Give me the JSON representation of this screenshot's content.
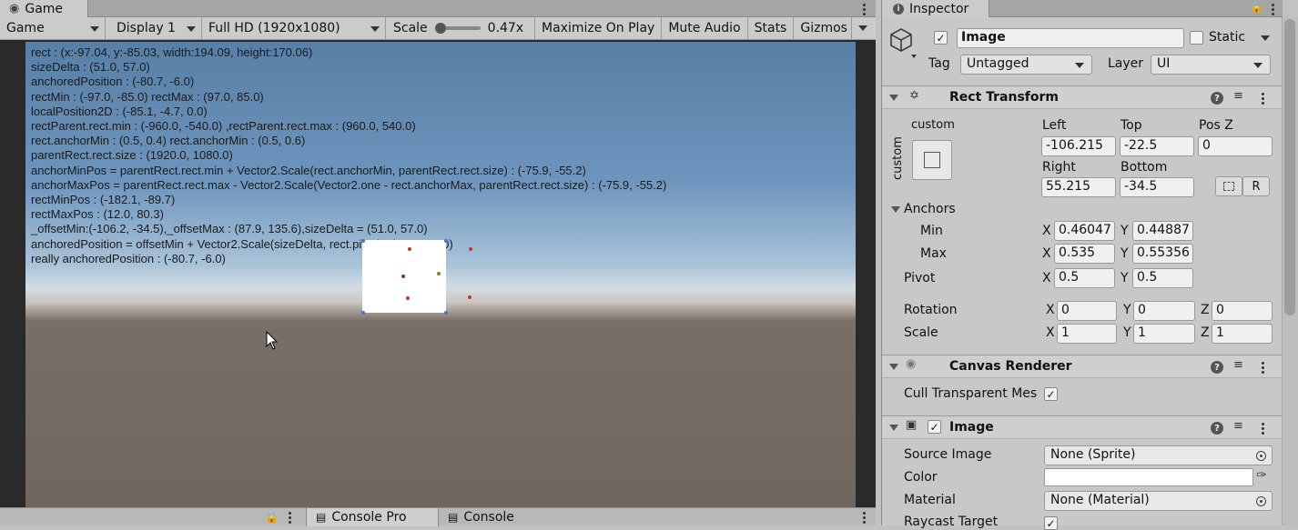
{
  "game": {
    "tab_label": "Game",
    "toolbar": {
      "view_mode": "Game",
      "display": "Display 1",
      "resolution": "Full HD (1920x1080)",
      "scale_label": "Scale",
      "scale_value": "0.47x",
      "scale_level": 0.0,
      "maximize_on_play": "Maximize On Play",
      "mute_audio": "Mute Audio",
      "stats": "Stats",
      "gizmos": "Gizmos"
    },
    "debug_lines": [
      "rect : (x:-97.04, y:-85.03, width:194.09, height:170.06)",
      "sizeDelta : (51.0, 57.0)",
      " anchoredPosition : (-80.7, -6.0)",
      " rectMin : (-97.0, -85.0)  rectMax : (97.0, 85.0)",
      " localPosition2D  : (-85.1, -4.7, 0.0)",
      " rectParent.rect.min   : (-960.0, -540.0) ,rectParent.rect.max   : (960.0, 540.0)",
      " rect.anchorMin   : (0.5, 0.4)   rect.anchorMin   : (0.5, 0.6)",
      " parentRect.rect.size   : (1920.0, 1080.0)",
      " anchorMinPos = parentRect.rect.min + Vector2.Scale(rect.anchorMin, parentRect.rect.size) : (-75.9, -55.2)",
      " anchorMaxPos = parentRect.rect.max - Vector2.Scale(Vector2.one - rect.anchorMax, parentRect.rect.size)  : (-75.9, -55.2)",
      " rectMinPos    : (-182.1, -89.7)",
      " rectMaxPos     : (12.0, 80.3)",
      " _offsetMin:(-106.2, -34.5),_offsetMax : (87.9, 135.6),sizeDelta = (51.0, 57.0)",
      " anchoredPosition = offsetMin + Vector2.Scale(sizeDelta, rect.pivot)      : (-80.7, -6.0)",
      " really anchoredPosition : (-80.7, -6.0)"
    ],
    "bottom_tabs": [
      "Console Pro",
      "Console"
    ]
  },
  "inspector": {
    "tab_label": "Inspector",
    "object": {
      "active": true,
      "name": "Image",
      "static_label": "Static",
      "static": false,
      "tag_label": "Tag",
      "tag": "Untagged",
      "layer_label": "Layer",
      "layer": "UI"
    },
    "rect_transform": {
      "title": "Rect Transform",
      "preset_label": "custom",
      "preset_side": "custom",
      "left_label": "Left",
      "left": "-106.215",
      "top_label": "Top",
      "top": "-22.5",
      "posz_label": "Pos Z",
      "posz": "0",
      "right_label": "Right",
      "right": "55.215",
      "bottom_label": "Bottom",
      "bottom": "-34.5",
      "r_button": "R",
      "anchors_label": "Anchors",
      "min_label": "Min",
      "min_x": "0.46047",
      "min_y": "0.44887",
      "max_label": "Max",
      "max_x": "0.535",
      "max_y": "0.55356",
      "pivot_label": "Pivot",
      "pivot_x": "0.5",
      "pivot_y": "0.5",
      "rotation_label": "Rotation",
      "rot_x": "0",
      "rot_y": "0",
      "rot_z": "0",
      "scale_label": "Scale",
      "scale_x": "1",
      "scale_y": "1",
      "scale_z": "1",
      "x": "X",
      "y": "Y",
      "z": "Z"
    },
    "canvas_renderer": {
      "title": "Canvas Renderer",
      "cull_label": "Cull Transparent Mes",
      "cull": true
    },
    "image": {
      "title": "Image",
      "enabled": true,
      "source_label": "Source Image",
      "source": "None (Sprite)",
      "color_label": "Color",
      "color": "#ffffff",
      "material_label": "Material",
      "material": "None (Material)",
      "raycast_label": "Raycast Target",
      "raycast": true
    }
  }
}
